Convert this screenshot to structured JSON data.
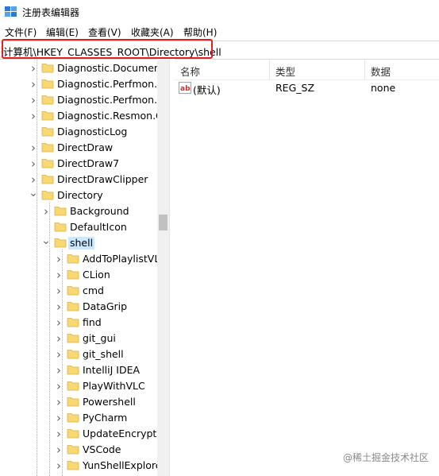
{
  "window": {
    "title": "注册表编辑器",
    "icon": "regedit-icon"
  },
  "menu": [
    "文件(F)",
    "编辑(E)",
    "查看(V)",
    "收藏夹(A)",
    "帮助(H)"
  ],
  "address": {
    "path": "计算机\\HKEY_CLASSES_ROOT\\Directory\\shell"
  },
  "tree": [
    {
      "label": "Diagnostic.Document",
      "state": "collapsed"
    },
    {
      "label": "Diagnostic.Perfmon.C",
      "state": "collapsed"
    },
    {
      "label": "Diagnostic.Perfmon.D",
      "state": "collapsed"
    },
    {
      "label": "Diagnostic.Resmon.C",
      "state": "collapsed"
    },
    {
      "label": "DiagnosticLog",
      "state": "leaf"
    },
    {
      "label": "DirectDraw",
      "state": "collapsed"
    },
    {
      "label": "DirectDraw7",
      "state": "collapsed"
    },
    {
      "label": "DirectDrawClipper",
      "state": "collapsed"
    },
    {
      "label": "Directory",
      "state": "expanded"
    },
    {
      "label": "Background",
      "state": "collapsed"
    },
    {
      "label": "DefaultIcon",
      "state": "leaf"
    },
    {
      "label": "shell",
      "state": "expanded",
      "selected": true
    },
    {
      "label": "AddToPlaylistVL",
      "state": "collapsed"
    },
    {
      "label": "CLion",
      "state": "collapsed"
    },
    {
      "label": "cmd",
      "state": "collapsed"
    },
    {
      "label": "DataGrip",
      "state": "collapsed"
    },
    {
      "label": "find",
      "state": "collapsed"
    },
    {
      "label": "git_gui",
      "state": "collapsed"
    },
    {
      "label": "git_shell",
      "state": "collapsed"
    },
    {
      "label": "IntelliJ IDEA",
      "state": "collapsed"
    },
    {
      "label": "PlayWithVLC",
      "state": "collapsed"
    },
    {
      "label": "Powershell",
      "state": "collapsed"
    },
    {
      "label": "PyCharm",
      "state": "collapsed"
    },
    {
      "label": "UpdateEncryptio",
      "state": "collapsed"
    },
    {
      "label": "VSCode",
      "state": "collapsed"
    },
    {
      "label": "YunShellExplore",
      "state": "collapsed"
    }
  ],
  "list": {
    "columns": [
      "名称",
      "类型",
      "数据"
    ],
    "rows": [
      {
        "name": "(默认)",
        "type": "REG_SZ",
        "data": "none",
        "icon": "string-value-icon"
      }
    ]
  },
  "watermark": "@稀土掘金技术社区",
  "colors": {
    "selection": "#cce8ff",
    "highlight_box": "#e02020",
    "folder": "#f8d775"
  }
}
